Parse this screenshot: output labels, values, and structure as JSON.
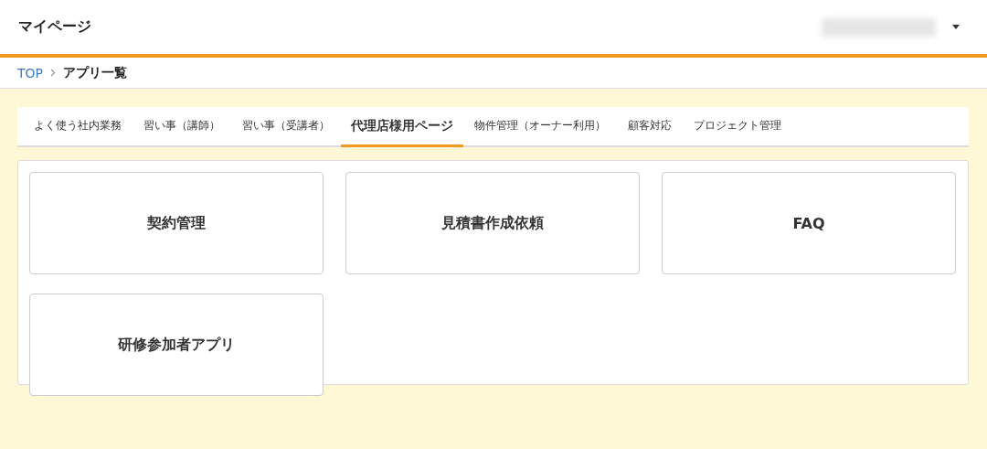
{
  "header": {
    "title": "マイページ"
  },
  "breadcrumb": [
    {
      "label": "TOP",
      "kind": "link"
    },
    {
      "label": "アプリ一覧",
      "kind": "current"
    }
  ],
  "tabs": [
    {
      "label": "よく使う社内業務",
      "selected": false
    },
    {
      "label": "習い事（講師）",
      "selected": false
    },
    {
      "label": "習い事（受講者）",
      "selected": false
    },
    {
      "label": "代理店様用ページ",
      "selected": true
    },
    {
      "label": "物件管理（オーナー利用）",
      "selected": false
    },
    {
      "label": "顧客対応",
      "selected": false
    },
    {
      "label": "プロジェクト管理",
      "selected": false
    }
  ],
  "apps": [
    "契約管理",
    "見積書作成依頼",
    "FAQ",
    "研修参加者アプリ"
  ]
}
